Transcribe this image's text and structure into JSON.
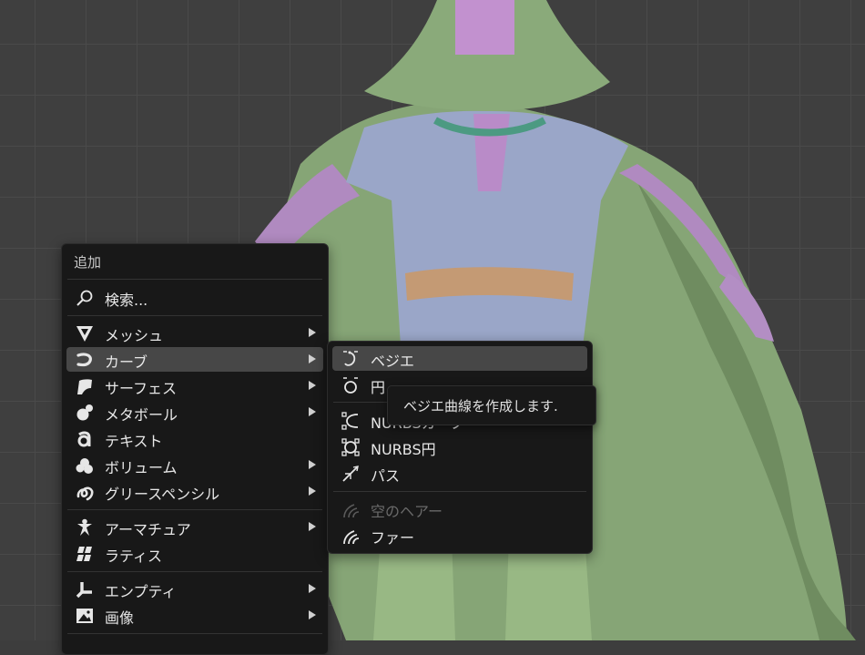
{
  "add_menu": {
    "title": "追加",
    "search_label": "検索...",
    "items": [
      {
        "label": "メッシュ",
        "icon": "mesh-icon",
        "has_submenu": true
      },
      {
        "label": "カーブ",
        "icon": "curve-icon",
        "has_submenu": true,
        "highlighted": true
      },
      {
        "label": "サーフェス",
        "icon": "surface-icon",
        "has_submenu": true
      },
      {
        "label": "メタボール",
        "icon": "metaball-icon",
        "has_submenu": true
      },
      {
        "label": "テキスト",
        "icon": "text-icon",
        "has_submenu": false
      },
      {
        "label": "ボリューム",
        "icon": "volume-icon",
        "has_submenu": true
      },
      {
        "label": "グリースペンシル",
        "icon": "grease-pencil-icon",
        "has_submenu": true
      },
      {
        "label": "アーマチュア",
        "icon": "armature-icon",
        "has_submenu": true
      },
      {
        "label": "ラティス",
        "icon": "lattice-icon",
        "has_submenu": false
      },
      {
        "label": "エンプティ",
        "icon": "empty-icon",
        "has_submenu": true
      },
      {
        "label": "画像",
        "icon": "image-icon",
        "has_submenu": true
      }
    ]
  },
  "curve_submenu": {
    "items": [
      {
        "label": "ベジエ",
        "icon": "bezier-curve-icon",
        "highlighted": true
      },
      {
        "label": "円",
        "icon": "circle-curve-icon"
      },
      {
        "label": "NURBSカーブ",
        "icon": "nurbs-curve-icon"
      },
      {
        "label": "NURBS円",
        "icon": "nurbs-circle-icon"
      },
      {
        "label": "パス",
        "icon": "path-icon"
      },
      {
        "label": "空のヘアー",
        "icon": "empty-hair-icon",
        "disabled": true
      },
      {
        "label": "ファー",
        "icon": "fur-icon"
      }
    ]
  },
  "tooltip": {
    "text": "ベジエ曲線を作成します."
  },
  "colors": {
    "menu_bg": "#181818",
    "highlight": "#474747",
    "viewport_bg": "#3f3f3f",
    "cape_green": "#8aa878",
    "tunic_blue": "#9aa6c8",
    "sleeve_purple": "#b48ac8"
  }
}
